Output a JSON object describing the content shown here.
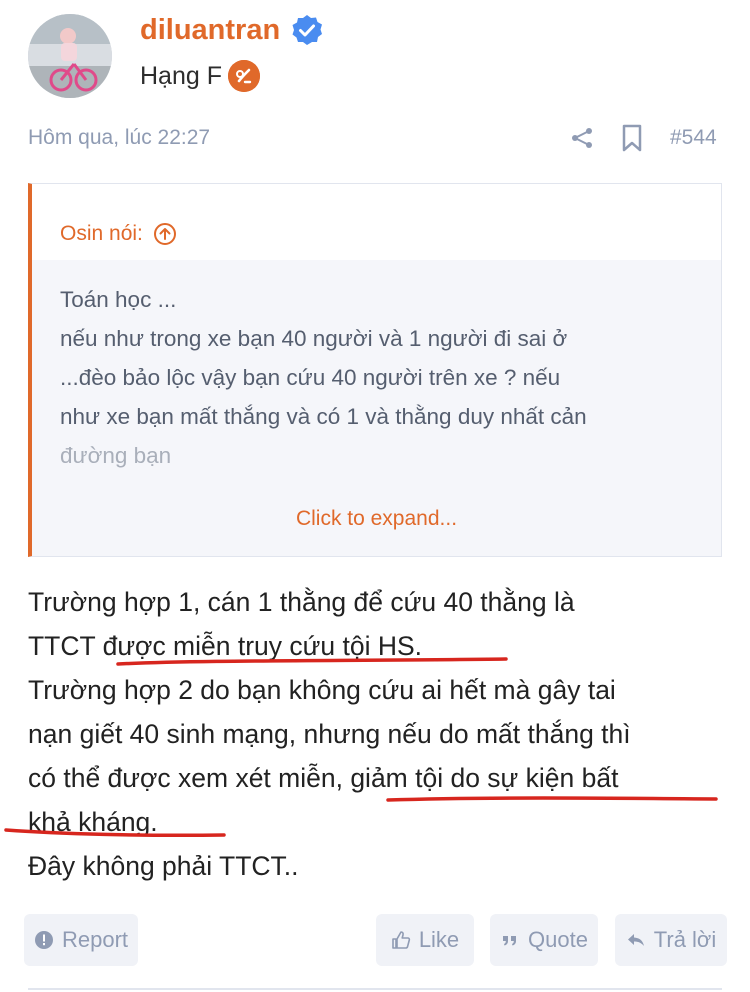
{
  "header": {
    "username": "diluantran",
    "rank": "Hạng F"
  },
  "meta": {
    "date": "Hôm qua, lúc 22:27",
    "post_number": "#544"
  },
  "quote": {
    "author_label": "Osin nói:",
    "lines": [
      "Toán học ...",
      "nếu như trong xe bạn 40 người và 1 người đi sai ở",
      "...đèo bảo lộc vậy bạn cứu 40 người trên xe ? nếu",
      "như xe bạn mất thắng và có 1 và thằng duy nhất cản",
      "đường bạn"
    ],
    "expand_label": "Click to expand..."
  },
  "post": {
    "lines": [
      "Trường hợp 1, cán 1 thằng để cứu 40 thằng là",
      "TTCT được miễn truy cứu tội HS.",
      "Trường hợp 2 do bạn không cứu ai hết mà gây tai",
      "nạn giết 40 sinh mạng, nhưng nếu do mất thắng thì",
      "có thể được xem xét miễn, giảm tội do sự kiện bất",
      "khả kháng.",
      "Đây không phải TTCT.."
    ]
  },
  "actions": {
    "report": "Report",
    "like": "Like",
    "quote": "Quote",
    "reply": "Trả lời"
  },
  "colors": {
    "accent": "#e0692a",
    "muted": "#8f9bb3",
    "verified": "#4a8cf0",
    "annotation": "#d7261e"
  }
}
